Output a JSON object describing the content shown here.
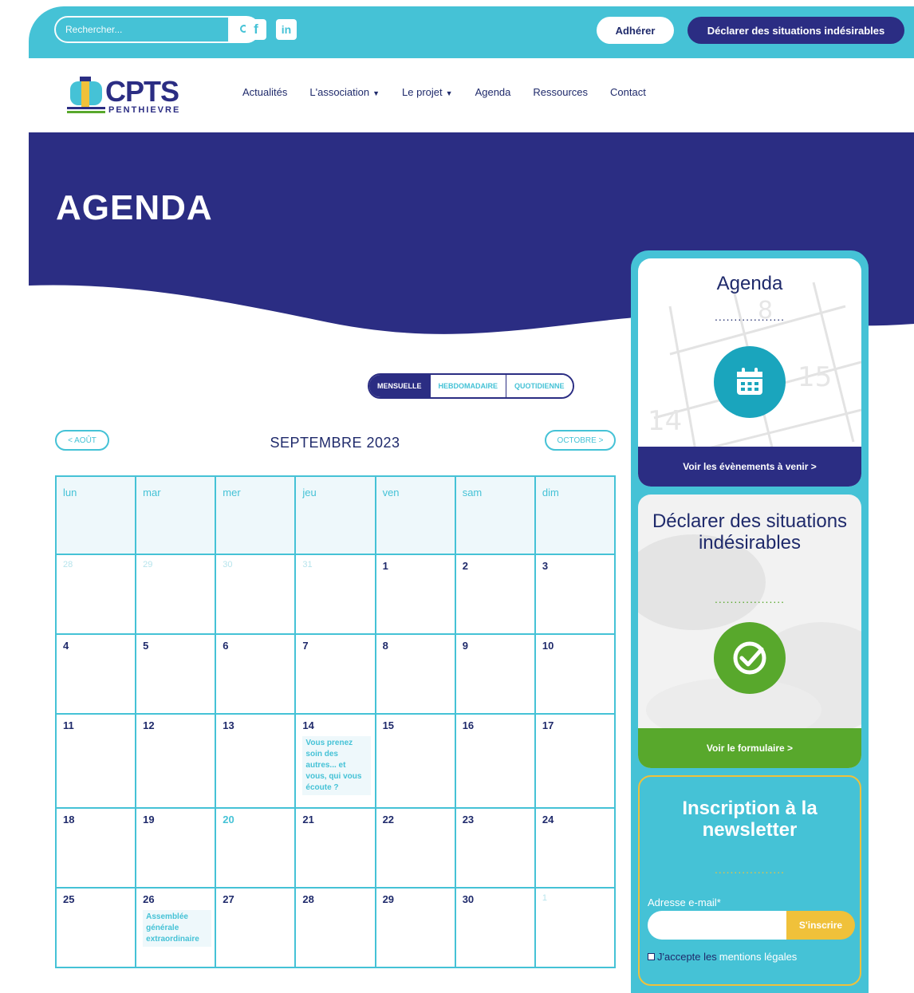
{
  "topbar": {
    "search_placeholder": "Rechercher...",
    "social": [
      {
        "name": "facebook-icon",
        "glyph": "f"
      },
      {
        "name": "linkedin-icon",
        "glyph": "in"
      }
    ],
    "adherer_label": "Adhérer",
    "declarer_label": "Déclarer des situations indésirables"
  },
  "logo": {
    "title": "CPTS",
    "subtitle": "PENTHIEVRE"
  },
  "nav": [
    {
      "label": "Actualités",
      "dropdown": false
    },
    {
      "label": "L'association",
      "dropdown": true
    },
    {
      "label": "Le projet",
      "dropdown": true
    },
    {
      "label": "Agenda",
      "dropdown": false
    },
    {
      "label": "Ressources",
      "dropdown": false
    },
    {
      "label": "Contact",
      "dropdown": false
    }
  ],
  "hero": {
    "title": "AGENDA"
  },
  "calendar": {
    "views": [
      "MENSUELLE",
      "HEBDOMADAIRE",
      "QUOTIDIENNE"
    ],
    "active_view": "MENSUELLE",
    "prev_label": "< AOÛT",
    "next_label": "OCTOBRE >",
    "month_title": "SEPTEMBRE 2023",
    "weekdays": [
      "lun",
      "mar",
      "mer",
      "jeu",
      "ven",
      "sam",
      "dim"
    ],
    "weeks": [
      [
        {
          "d": "28",
          "other": true
        },
        {
          "d": "29",
          "other": true
        },
        {
          "d": "30",
          "other": true
        },
        {
          "d": "31",
          "other": true
        },
        {
          "d": "1"
        },
        {
          "d": "2"
        },
        {
          "d": "3"
        }
      ],
      [
        {
          "d": "4"
        },
        {
          "d": "5"
        },
        {
          "d": "6"
        },
        {
          "d": "7"
        },
        {
          "d": "8"
        },
        {
          "d": "9"
        },
        {
          "d": "10"
        }
      ],
      [
        {
          "d": "11"
        },
        {
          "d": "12"
        },
        {
          "d": "13"
        },
        {
          "d": "14",
          "event": "Vous prenez soin des autres... et vous, qui vous écoute ?"
        },
        {
          "d": "15"
        },
        {
          "d": "16"
        },
        {
          "d": "17"
        }
      ],
      [
        {
          "d": "18"
        },
        {
          "d": "19"
        },
        {
          "d": "20",
          "today": true
        },
        {
          "d": "21"
        },
        {
          "d": "22"
        },
        {
          "d": "23"
        },
        {
          "d": "24"
        }
      ],
      [
        {
          "d": "25"
        },
        {
          "d": "26",
          "event": "Assemblée générale extraordinaire"
        },
        {
          "d": "27"
        },
        {
          "d": "28"
        },
        {
          "d": "29"
        },
        {
          "d": "30"
        },
        {
          "d": "1",
          "other": true
        }
      ]
    ]
  },
  "sidebar": {
    "agenda_card": {
      "title": "Agenda",
      "dots": "..................",
      "footer": "Voir les évènements à venir >"
    },
    "declare_card": {
      "title": "Déclarer des situations indésirables",
      "dots": "..................",
      "footer": "Voir le formulaire >"
    },
    "newsletter": {
      "title": "Inscription à la newsletter",
      "dots": "..................",
      "email_label": "Adresse e-mail*",
      "submit_label": "S'inscrire",
      "accept_prefix": "J'accepte les",
      "accept_link": "mentions légales"
    }
  },
  "colors": {
    "turquoise": "#45c2d6",
    "navy": "#2b2d83",
    "green": "#58a82c",
    "yellow": "#f0c13a"
  }
}
